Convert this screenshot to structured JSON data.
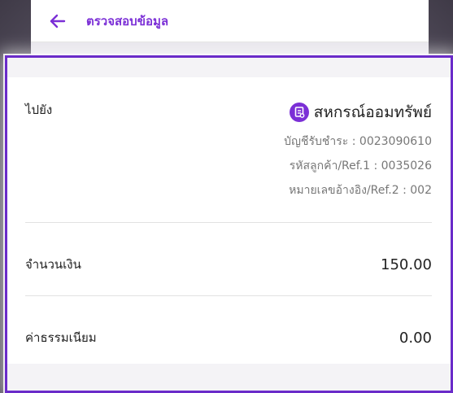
{
  "header": {
    "back_icon": "arrow-left-icon",
    "title": "ตรวจสอบข้อมูล",
    "accent_color": "#7b2fd6"
  },
  "transfer": {
    "to_label": "ไปยัง",
    "payee_icon": "cooperative-badge-icon",
    "payee_name": "สหกรณ์ออมทรัพย์",
    "account_line": "บัญชีรับชำระ : 0023090610",
    "ref1_line": "รหัสลูกค้า/Ref.1 : 0035026",
    "ref2_line": "หมายเลขอ้างอิง/Ref.2 : 002"
  },
  "amount": {
    "label": "จำนวนเงิน",
    "value": "150.00"
  },
  "fee": {
    "label": "ค่าธรรมเนียม",
    "value": "0.00"
  },
  "highlight_color": "#6a2bc9"
}
